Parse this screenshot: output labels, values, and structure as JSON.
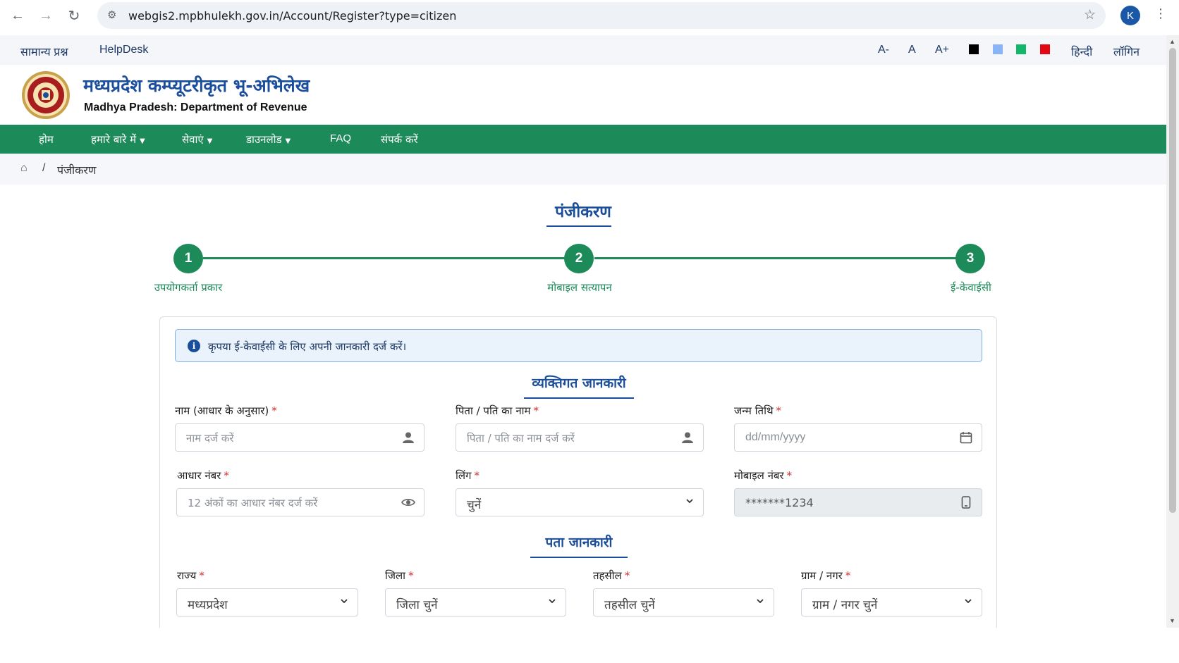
{
  "browser": {
    "url": "webgis2.mpbhulekh.gov.in/Account/Register?type=citizen",
    "profile_initial": "K"
  },
  "topbar": {
    "faq": "सामान्य प्रश्न",
    "helpdesk": "HelpDesk",
    "font_decrease": "A-",
    "font_normal": "A",
    "font_increase": "A+",
    "theme_colors": [
      "#000000",
      "#8ab4f8",
      "#12b76a",
      "#e30613"
    ],
    "language": "हिन्दी",
    "login": "लॉगिन"
  },
  "header": {
    "title": "मध्यप्रदेश कम्प्यूटरीकृत भू-अभिलेख",
    "subtitle": "Madhya Pradesh: Department of Revenue"
  },
  "mainnav": {
    "home": "होम",
    "about": "हमारे बारे में",
    "services": "सेवाएं",
    "download": "डाउनलोड",
    "faq": "FAQ",
    "contact": "संपर्क करें"
  },
  "breadcrumb": {
    "separator": "/",
    "current": "पंजीकरण"
  },
  "page": {
    "title": "पंजीकरण"
  },
  "steps": [
    {
      "number": "1",
      "label": "उपयोगकर्ता प्रकार"
    },
    {
      "number": "2",
      "label": "मोबाइल सत्यापन"
    },
    {
      "number": "3",
      "label": "ई-केवाईसी"
    }
  ],
  "alert": {
    "text": "कृपया ई-केवाईसी के लिए अपनी जानकारी दर्ज करें।"
  },
  "personal": {
    "title": "व्यक्तिगत जानकारी",
    "name_label": "नाम (आधार के अनुसार)",
    "name_placeholder": "नाम दर्ज करें",
    "father_label": "पिता / पति का नाम",
    "father_placeholder": "पिता / पति का नाम दर्ज करें",
    "dob_label": "जन्म तिथि",
    "dob_placeholder": "dd/mm/yyyy",
    "aadhaar_label": "आधार नंबर",
    "aadhaar_placeholder": "12 अंकों का आधार नंबर दर्ज करें",
    "gender_label": "लिंग",
    "gender_value": "चुनें",
    "mobile_label": "मोबाइल नंबर",
    "mobile_value": "*******1234",
    "required_mark": "*"
  },
  "address": {
    "title": "पता जानकारी",
    "state_label": "राज्य",
    "state_value": "मध्यप्रदेश",
    "district_label": "जिला",
    "district_value": "जिला चुनें",
    "tehsil_label": "तहसील",
    "tehsil_value": "तहसील चुनें",
    "village_label": "ग्राम / नगर",
    "village_value": "ग्राम / नगर चुनें"
  }
}
